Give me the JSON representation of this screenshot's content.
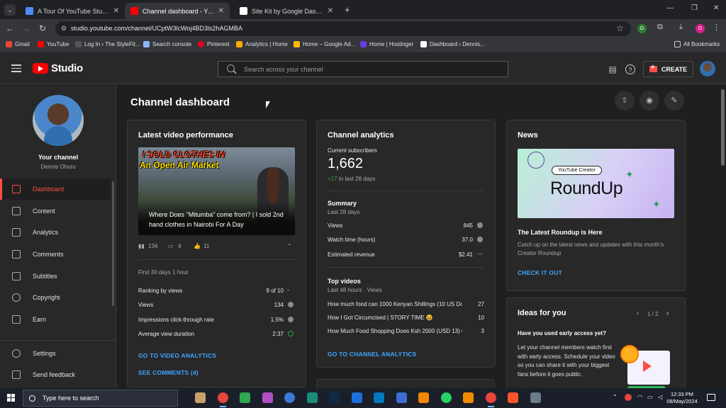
{
  "browser": {
    "tabs": [
      {
        "title": "A Tour Of YouTube Studio By A",
        "color": "#4c8bf5",
        "active": false
      },
      {
        "title": "Channel dashboard - YouTube",
        "color": "#ff0000",
        "active": true
      },
      {
        "title": "Site Kit by Google Dashboard ‹",
        "color": "#ffffff",
        "active": false
      }
    ],
    "url": "studio.youtube.com/channel/UCptW3lcWoj4BD3ls2hAGMBA",
    "profile_initial": "D",
    "ext_initial": "G",
    "bookmarks": [
      {
        "label": "Gmail",
        "color": "#ea4335"
      },
      {
        "label": "YouTube",
        "color": "#ff0000"
      },
      {
        "label": "Log In ‹ The StyleFit...",
        "color": "#3a3a3a"
      },
      {
        "label": "Search console",
        "color": "#8ab4f8"
      },
      {
        "label": "Pinterest",
        "color": "#e60023"
      },
      {
        "label": "Analytics | Home",
        "color": "#f9ab00"
      },
      {
        "label": "Home – Google Ad...",
        "color": "#fbbc04"
      },
      {
        "label": "Home | Hostinger",
        "color": "#673de6"
      },
      {
        "label": "Dashboard ‹ Dennis...",
        "color": "#ffffff"
      }
    ],
    "all_bookmarks": "All Bookmarks"
  },
  "header": {
    "logo_text": "Studio",
    "search_placeholder": "Search across your channel",
    "create_label": "CREATE"
  },
  "sidebar": {
    "channel_title": "Your channel",
    "channel_name": "Dennis Ohuru",
    "items": [
      {
        "label": "Dashboard",
        "icon": "dashboard-icon",
        "active": true
      },
      {
        "label": "Content",
        "icon": "content-icon",
        "active": false
      },
      {
        "label": "Analytics",
        "icon": "analytics-icon",
        "active": false
      },
      {
        "label": "Comments",
        "icon": "comments-icon",
        "active": false
      },
      {
        "label": "Subtitles",
        "icon": "subtitles-icon",
        "active": false
      },
      {
        "label": "Copyright",
        "icon": "copyright-icon",
        "active": false
      },
      {
        "label": "Earn",
        "icon": "earn-icon",
        "active": false
      }
    ],
    "bottom_items": [
      {
        "label": "Settings",
        "icon": "gear-icon"
      },
      {
        "label": "Send feedback",
        "icon": "feedback-icon"
      }
    ]
  },
  "main": {
    "title": "Channel dashboard",
    "latest_video": {
      "heading": "Latest video performance",
      "thumb_line1": "I SOLD CLOTHES IN",
      "thumb_line2": "An Open Air Market",
      "caption": "Where Does \"Mitumba\" come from? | I sold 2nd hand clothes in Nairobi For A Day",
      "views_count": "134",
      "comments_count": "4",
      "likes_count": "11",
      "period": "First 30 days 1 hour",
      "rows": [
        {
          "label": "Ranking by views",
          "value": "9 of 10"
        },
        {
          "label": "Views",
          "value": "134"
        },
        {
          "label": "Impressions click-through rate",
          "value": "1.5%"
        },
        {
          "label": "Average view duration",
          "value": "2:37"
        }
      ],
      "link_analytics": "GO TO VIDEO ANALYTICS",
      "link_comments": "SEE COMMENTS (4)"
    },
    "analytics": {
      "heading": "Channel analytics",
      "subs_label": "Current subscribers",
      "subs_value": "1,662",
      "subs_delta": "+17",
      "subs_delta_suffix": "in last 28 days",
      "summary_title": "Summary",
      "summary_period": "Last 28 days",
      "summary_rows": [
        {
          "label": "Views",
          "value": "845"
        },
        {
          "label": "Watch time (hours)",
          "value": "37.0"
        },
        {
          "label": "Estimated revenue",
          "value": "$2.41"
        }
      ],
      "top_title": "Top videos",
      "top_period": "Last 48 hours · Views",
      "top_videos": [
        {
          "title": "How much food can 1000 Kenyan Shillings (10 US Dol...",
          "views": "27"
        },
        {
          "title": "How I Got Circumcised | STORY TIME 😆",
          "views": "10"
        },
        {
          "title": "How Much Food Shopping Does Ksh 2000 (USD 13) G...",
          "views": "3"
        }
      ],
      "link": "GO TO CHANNEL ANALYTICS"
    },
    "news": {
      "heading": "News",
      "img_pill": "YouTube Creator",
      "img_title": "RoundUp",
      "title": "The Latest Roundup is Here",
      "body": "Catch up on the latest news and updates with this month's Creator Roundup",
      "link": "CHECK IT OUT"
    },
    "ideas": {
      "heading": "Ideas for you",
      "pager": "1 / 2",
      "question": "Have you used early access yet?",
      "body": "Let your channel members watch first with early access. Schedule your video so you can share it with your biggest fans before it goes public."
    }
  },
  "taskbar": {
    "search_placeholder": "Type here to search",
    "time": "12:33 PM",
    "date": "08/May/2024",
    "apps": [
      {
        "name": "library-icon",
        "color": "#c9a06a"
      },
      {
        "name": "chrome-icon",
        "color": "#e8453c"
      },
      {
        "name": "edge-icon",
        "color": "#2fa84f"
      },
      {
        "name": "media-icon",
        "color": "#b04fc5"
      },
      {
        "name": "qbittorrent-icon",
        "color": "#3a7bd5"
      },
      {
        "name": "store-icon",
        "color": "#1c8c7a"
      },
      {
        "name": "photoshop-icon",
        "color": "#0f2a44"
      },
      {
        "name": "dev-icon",
        "color": "#1e6fd9"
      },
      {
        "name": "trello-icon",
        "color": "#0079bf"
      },
      {
        "name": "remote-icon",
        "color": "#3c6fd1"
      },
      {
        "name": "vlc-icon",
        "color": "#f28705"
      },
      {
        "name": "whatsapp-icon",
        "color": "#25d366"
      },
      {
        "name": "text-icon",
        "color": "#f08c00"
      },
      {
        "name": "chrome-icon",
        "color": "#e8453c"
      },
      {
        "name": "brave-icon",
        "color": "#fb542b"
      },
      {
        "name": "settings-app-icon",
        "color": "#6c7a89"
      }
    ]
  },
  "colors": {
    "accent_red": "#ff4e45",
    "link_blue": "#3ea6ff",
    "positive_green": "#2ba640"
  }
}
